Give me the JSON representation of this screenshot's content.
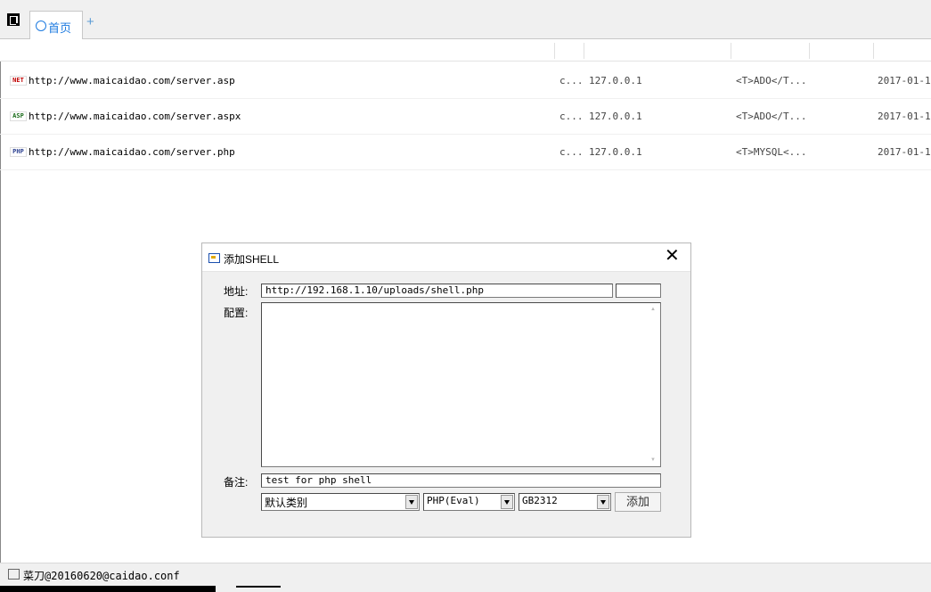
{
  "tabs": {
    "home_label": "首页",
    "add_label": "+"
  },
  "table": {
    "rows": [
      {
        "type_icon": "NET",
        "url": "http://www.maicaidao.com/server.asp",
        "col1": "c...",
        "ip": "127.0.0.1",
        "db": "<T>ADO</T...",
        "date": "2017-01-1"
      },
      {
        "type_icon": "ASP",
        "url": "http://www.maicaidao.com/server.aspx",
        "col1": "c...",
        "ip": "127.0.0.1",
        "db": "<T>ADO</T...",
        "date": "2017-01-1"
      },
      {
        "type_icon": "PHP",
        "url": "http://www.maicaidao.com/server.php",
        "col1": "c...",
        "ip": "127.0.0.1",
        "db": "<T>MYSQL<...",
        "date": "2017-01-1"
      }
    ]
  },
  "dialog": {
    "title": "添加SHELL",
    "close": "✕",
    "address_label": "地址:",
    "address_value": "http://192.168.1.10/uploads/shell.php",
    "password_value": "",
    "config_label": "配置:",
    "config_value": "",
    "note_label": "备注:",
    "note_value": "test for php shell",
    "category_value": "默认类别",
    "script_type_value": "PHP(Eval)",
    "encoding_value": "GB2312",
    "add_button": "添加"
  },
  "status": {
    "text": "菜刀@20160620@caidao.conf"
  }
}
